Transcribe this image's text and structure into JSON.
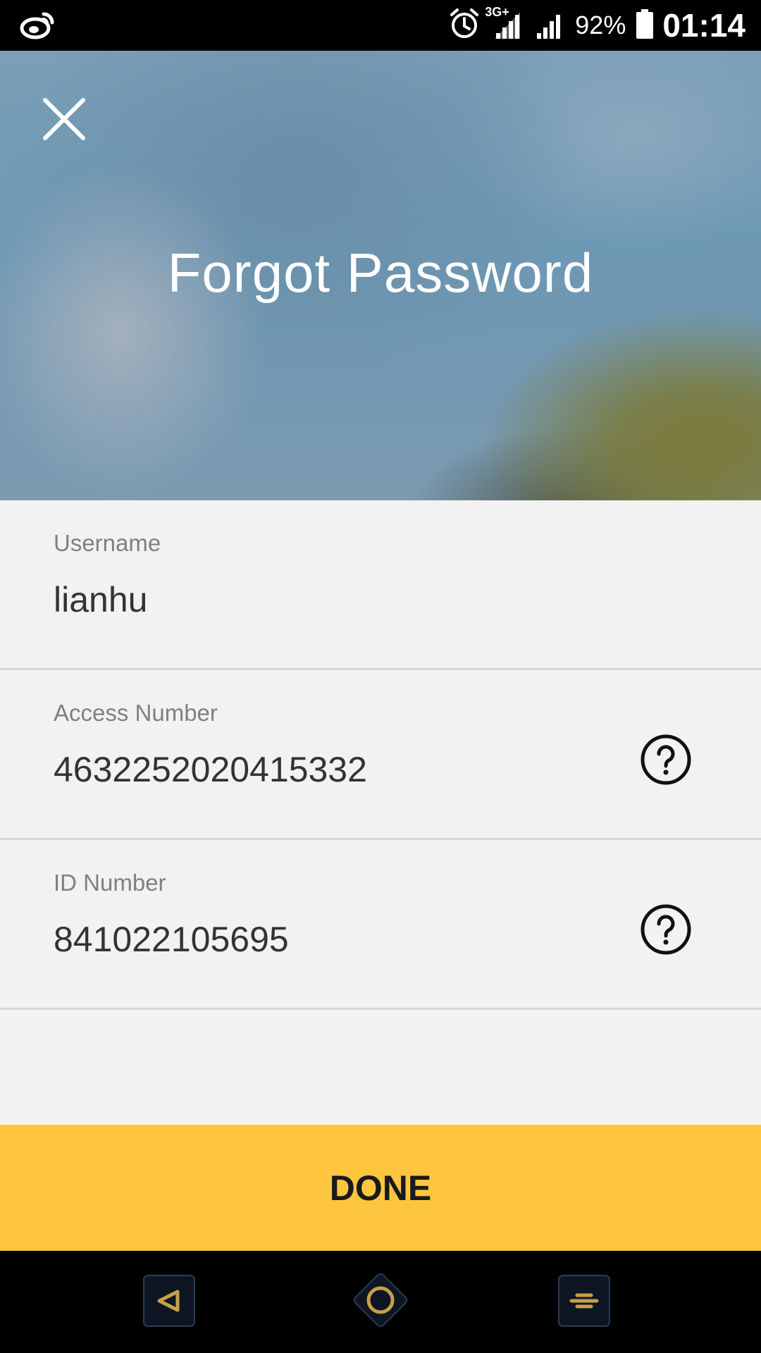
{
  "status_bar": {
    "left_icon": "weibo-icon",
    "alarm_icon": "alarm-clock-icon",
    "network_tag": "3G+",
    "battery_percent": "92%",
    "time": "01:14"
  },
  "header": {
    "title": "Forgot Password",
    "close_icon": "close-icon"
  },
  "form": {
    "username": {
      "label": "Username",
      "value": "lianhu"
    },
    "access_number": {
      "label": "Access Number",
      "value": "4632252020415332",
      "help_icon": "question-circle-icon"
    },
    "id_number": {
      "label": "ID Number",
      "value": "841022105695",
      "help_icon": "question-circle-icon"
    }
  },
  "done_button": {
    "label": "DONE",
    "color": "#fec63f"
  },
  "nav_bar": {
    "back_icon": "back-triangle-icon",
    "home_icon": "home-circle-icon",
    "menu_icon": "menu-lines-icon",
    "accent_color": "#c8a045"
  }
}
